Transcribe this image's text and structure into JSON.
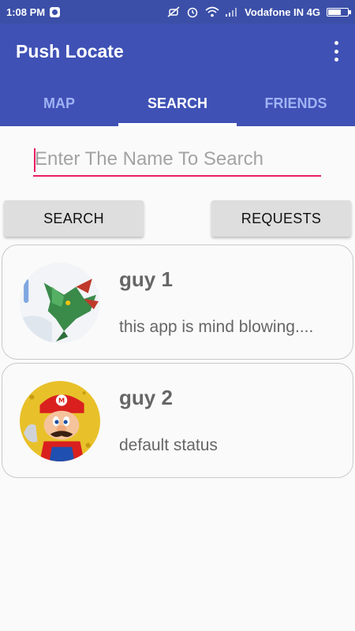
{
  "status_bar": {
    "time": "1:08 PM",
    "carrier": "Vodafone IN 4G",
    "icons": [
      "whatsapp-icon",
      "mute-icon",
      "alarm-icon",
      "wifi-icon",
      "signal-icon",
      "battery-icon"
    ]
  },
  "app_bar": {
    "title": "Push Locate",
    "menu_icon": "overflow-menu-icon"
  },
  "tabs": [
    {
      "label": "MAP",
      "active": false
    },
    {
      "label": "SEARCH",
      "active": true
    },
    {
      "label": "FRIENDS",
      "active": false
    }
  ],
  "search": {
    "placeholder": "Enter The Name To Search",
    "value": ""
  },
  "buttons": {
    "search": "SEARCH",
    "requests": "REQUESTS"
  },
  "results": [
    {
      "name": "guy 1",
      "status": "this app is mind blowing....",
      "avatar": "rayquaza-avatar"
    },
    {
      "name": "guy 2",
      "status": "default status",
      "avatar": "mario-avatar"
    }
  ],
  "colors": {
    "primary": "#3f51b5",
    "status_bar": "#3b4fa8",
    "accent": "#e91e63",
    "tab_inactive": "#9fb3f5"
  }
}
